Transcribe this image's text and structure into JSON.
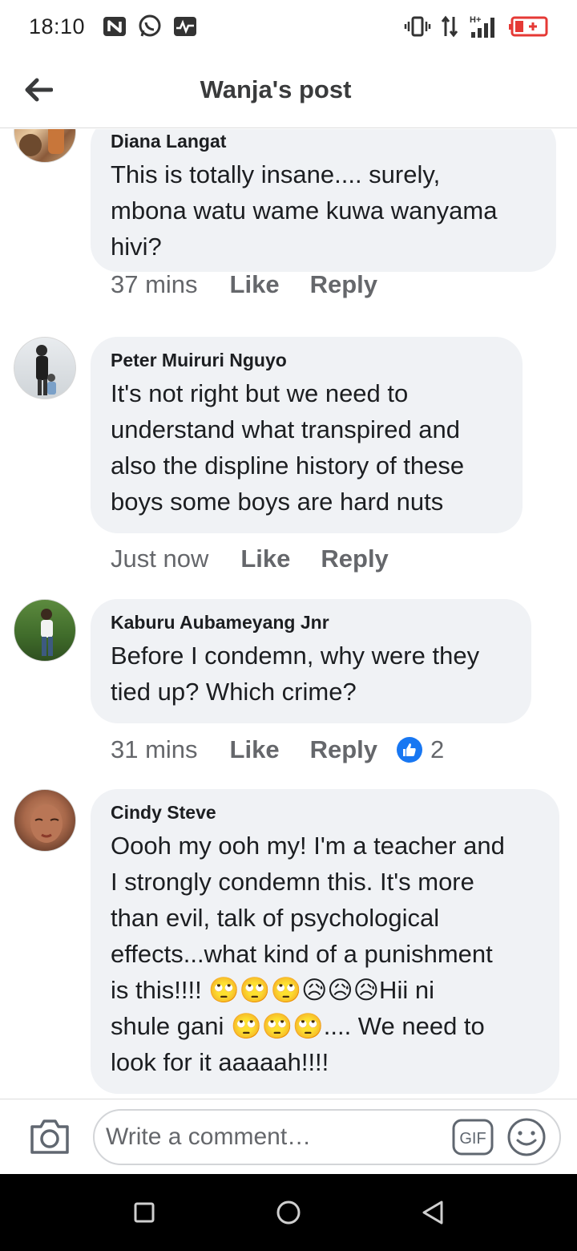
{
  "status_bar": {
    "time": "18:10",
    "left_icons": [
      "n-badge-icon",
      "whatsapp-icon",
      "activity-icon"
    ],
    "right_icons": [
      "vibrate-icon",
      "data-arrows-icon",
      "signal-icon",
      "battery-icon"
    ],
    "network_label": "H+"
  },
  "header": {
    "title": "Wanja's post",
    "back_icon": "back-arrow-icon"
  },
  "comments": [
    {
      "name": "Diana Langat",
      "text": "This is totally insane.... surely,\nmbona watu wame kuwa wanyama\nhivi?",
      "time": "37 mins",
      "like_label": "Like",
      "reply_label": "Reply"
    },
    {
      "name": "Peter Muiruri Nguyo",
      "text": "It's not right but we need to\nunderstand what transpired and\nalso the displine history of these\nboys some boys are hard nuts",
      "time": "Just now",
      "like_label": "Like",
      "reply_label": "Reply"
    },
    {
      "name": "Kaburu Aubameyang Jnr",
      "text": "Before I condemn, why were they\ntied up? Which crime?",
      "time": "31 mins",
      "like_label": "Like",
      "reply_label": "Reply",
      "reaction_count": "2",
      "reaction_icon": "like-thumb-icon"
    },
    {
      "name": "Cindy Steve",
      "text": "Oooh my ooh my! I'm a teacher and\nI strongly condemn this. It's more\nthan evil, talk of psychological\neffects...what kind of a punishment\nis this!!!! 🙄🙄🙄😥😥😥Hii ni\nshule gani 🙄🙄🙄.... We need to\nlook for it aaaaah!!!!"
    }
  ],
  "composer": {
    "placeholder": "Write a comment…",
    "gif_label": "GIF",
    "camera_icon": "camera-icon",
    "emoji_icon": "smiley-icon"
  },
  "nav_bar": {
    "icons": [
      "recents-square-icon",
      "home-circle-icon",
      "back-triangle-icon"
    ]
  },
  "colors": {
    "bubble": "#f0f2f5",
    "secondary_text": "#65676b",
    "like_blue": "#1877f2"
  }
}
